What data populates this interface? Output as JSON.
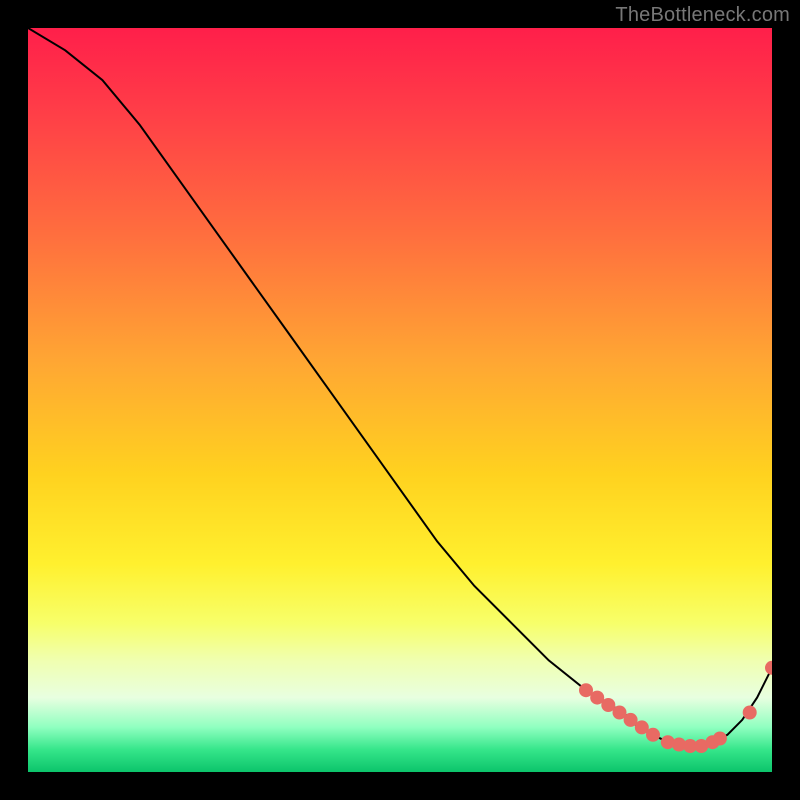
{
  "watermark": "TheBottleneck.com",
  "chart_data": {
    "type": "line",
    "title": "",
    "xlabel": "",
    "ylabel": "",
    "xlim": [
      0,
      100
    ],
    "ylim": [
      0,
      100
    ],
    "series": [
      {
        "name": "curve",
        "x": [
          0,
          5,
          10,
          15,
          20,
          25,
          30,
          35,
          40,
          45,
          50,
          55,
          60,
          65,
          70,
          75,
          80,
          82,
          84,
          86,
          88,
          90,
          92,
          94,
          96,
          98,
          100
        ],
        "values": [
          100,
          97,
          93,
          87,
          80,
          73,
          66,
          59,
          52,
          45,
          38,
          31,
          25,
          20,
          15,
          11,
          8,
          6,
          5,
          4,
          3.5,
          3.5,
          4,
          5,
          7,
          10,
          14
        ]
      }
    ],
    "points": [
      {
        "x": 75,
        "y": 11
      },
      {
        "x": 76.5,
        "y": 10
      },
      {
        "x": 78,
        "y": 9
      },
      {
        "x": 79.5,
        "y": 8
      },
      {
        "x": 81,
        "y": 7
      },
      {
        "x": 82.5,
        "y": 6
      },
      {
        "x": 84,
        "y": 5
      },
      {
        "x": 86,
        "y": 4
      },
      {
        "x": 87.5,
        "y": 3.7
      },
      {
        "x": 89,
        "y": 3.5
      },
      {
        "x": 90.5,
        "y": 3.5
      },
      {
        "x": 92,
        "y": 4
      },
      {
        "x": 93,
        "y": 4.5
      },
      {
        "x": 97,
        "y": 8
      },
      {
        "x": 100,
        "y": 14
      }
    ],
    "colors": {
      "curve": "#000000",
      "dots": "#e86a63",
      "gradient_top": "#ff1f4a",
      "gradient_mid": "#ffe845",
      "gradient_bottom": "#0cc46b"
    }
  }
}
